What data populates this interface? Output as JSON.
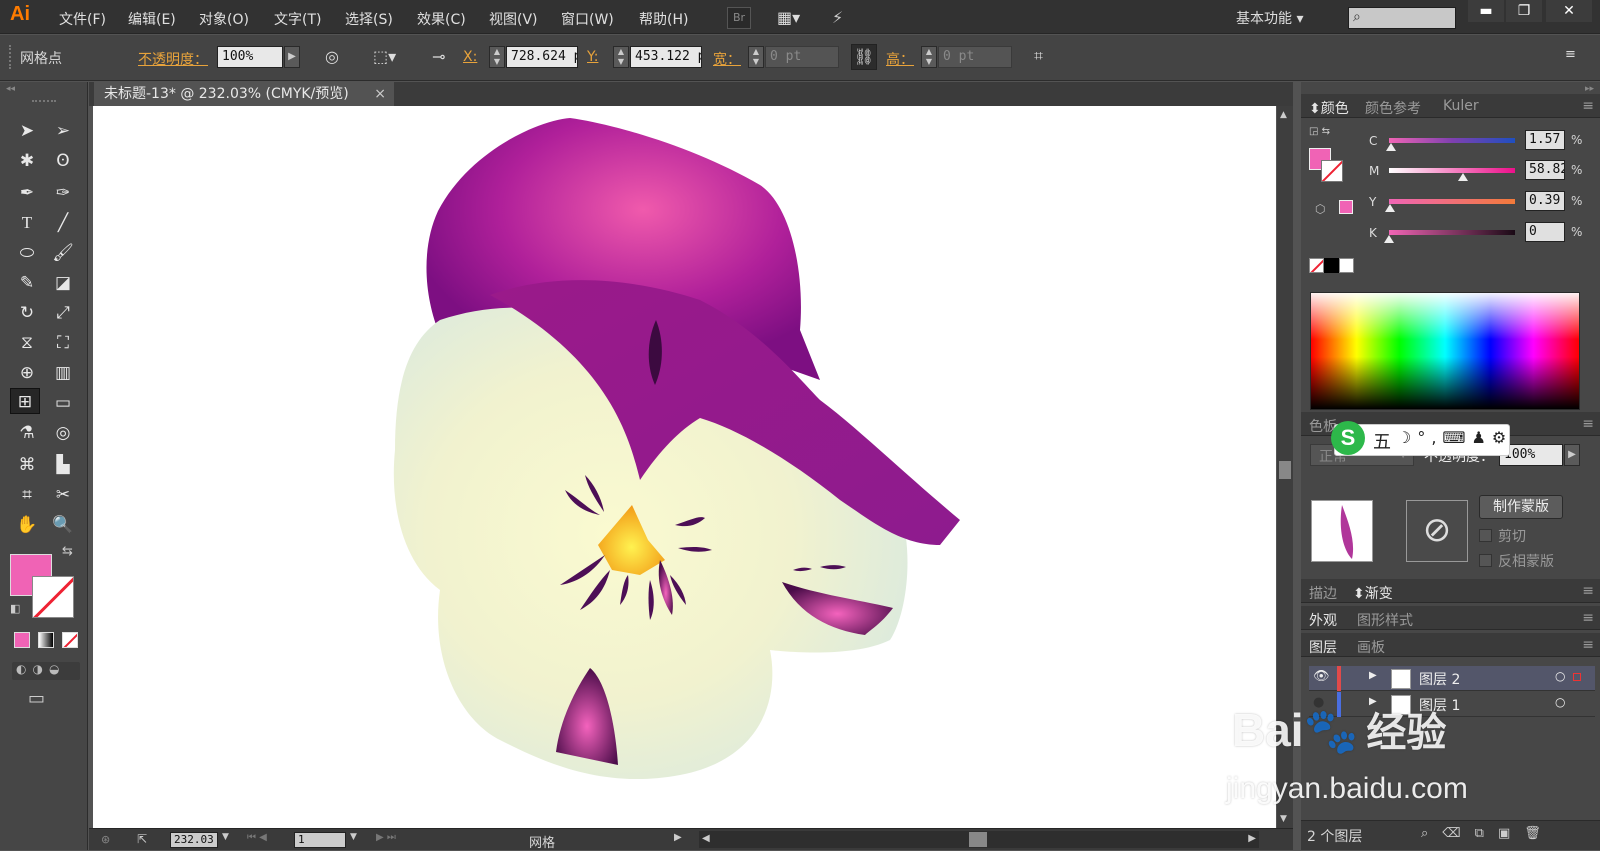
{
  "app": {
    "logo": "Ai"
  },
  "menu": [
    "文件(F)",
    "编辑(E)",
    "对象(O)",
    "文字(T)",
    "选择(S)",
    "效果(C)",
    "视图(V)",
    "窗口(W)",
    "帮助(H)"
  ],
  "menubar": {
    "br_label": "Br",
    "workspace": "基本功能",
    "minimize": "▬",
    "restore": "❐",
    "close": "✕"
  },
  "control": {
    "object_type": "网格点",
    "opacity_label": "不透明度：",
    "opacity_value": "100%",
    "x_label": "X:",
    "x_value": "728.624 p",
    "y_label": "Y:",
    "y_value": "453.122 p",
    "w_label": "宽：",
    "w_value": "0 pt",
    "h_label": "高：",
    "h_value": "0 pt"
  },
  "doc_tab": {
    "title": "未标题-13* @ 232.03% (CMYK/预览)",
    "close": "×"
  },
  "status": {
    "zoom": "232.03",
    "artboard": "1",
    "mode": "网格"
  },
  "color_panel": {
    "tabs": [
      "颜色",
      "颜色参考",
      "Kuler"
    ],
    "channels": [
      {
        "label": "C",
        "value": "1.57"
      },
      {
        "label": "M",
        "value": "58.82"
      },
      {
        "label": "Y",
        "value": "0.39"
      },
      {
        "label": "K",
        "value": "0"
      }
    ],
    "unit": "%",
    "fill": "#f063b5"
  },
  "transparency": {
    "tab": "色板",
    "blend_mode": "正常",
    "opacity_label": "不透明度：",
    "opacity_value": "100%",
    "make_mask": "制作蒙版",
    "clip": "剪切",
    "invert": "反相蒙版"
  },
  "stroke_tabs": [
    "描边",
    "渐变"
  ],
  "appearance_tabs": [
    "外观",
    "图形样式"
  ],
  "layers": {
    "tabs": [
      "图层",
      "画板"
    ],
    "items": [
      "图层 2",
      "图层 1"
    ],
    "count": "2 个图层"
  },
  "ime": {
    "label": "五"
  },
  "watermark": {
    "brand": "Bai",
    "brand2": "经验",
    "url": "jingyan.baidu.com"
  }
}
